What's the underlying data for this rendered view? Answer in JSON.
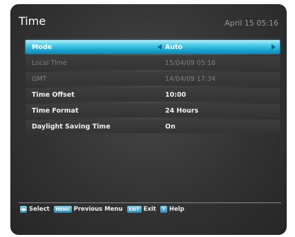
{
  "header": {
    "title": "Time",
    "datetime": "April 15 05:16"
  },
  "menu": [
    {
      "label": "Mode",
      "value": "Auto"
    },
    {
      "label": "Local Time",
      "value": "15/04/09 05:16"
    },
    {
      "label": "GMT",
      "value": "14/04/09 17:34"
    },
    {
      "label": "Time Offset",
      "value": "10:00"
    },
    {
      "label": "Time Format",
      "value": "24 Hours"
    },
    {
      "label": "Daylight Saving Time",
      "value": "On"
    }
  ],
  "footer": {
    "select_key": "◀▶",
    "select": "Select",
    "menu_key": "MENU",
    "previous_menu": "Previous Menu",
    "exit_key": "EXIT",
    "exit": "Exit",
    "help_key": "?",
    "help": "Help"
  },
  "colors": {
    "highlight": "#1aa9d2",
    "background": "#333333",
    "row": "#3a3a3a",
    "disabled_text": "#7e7e7e"
  }
}
